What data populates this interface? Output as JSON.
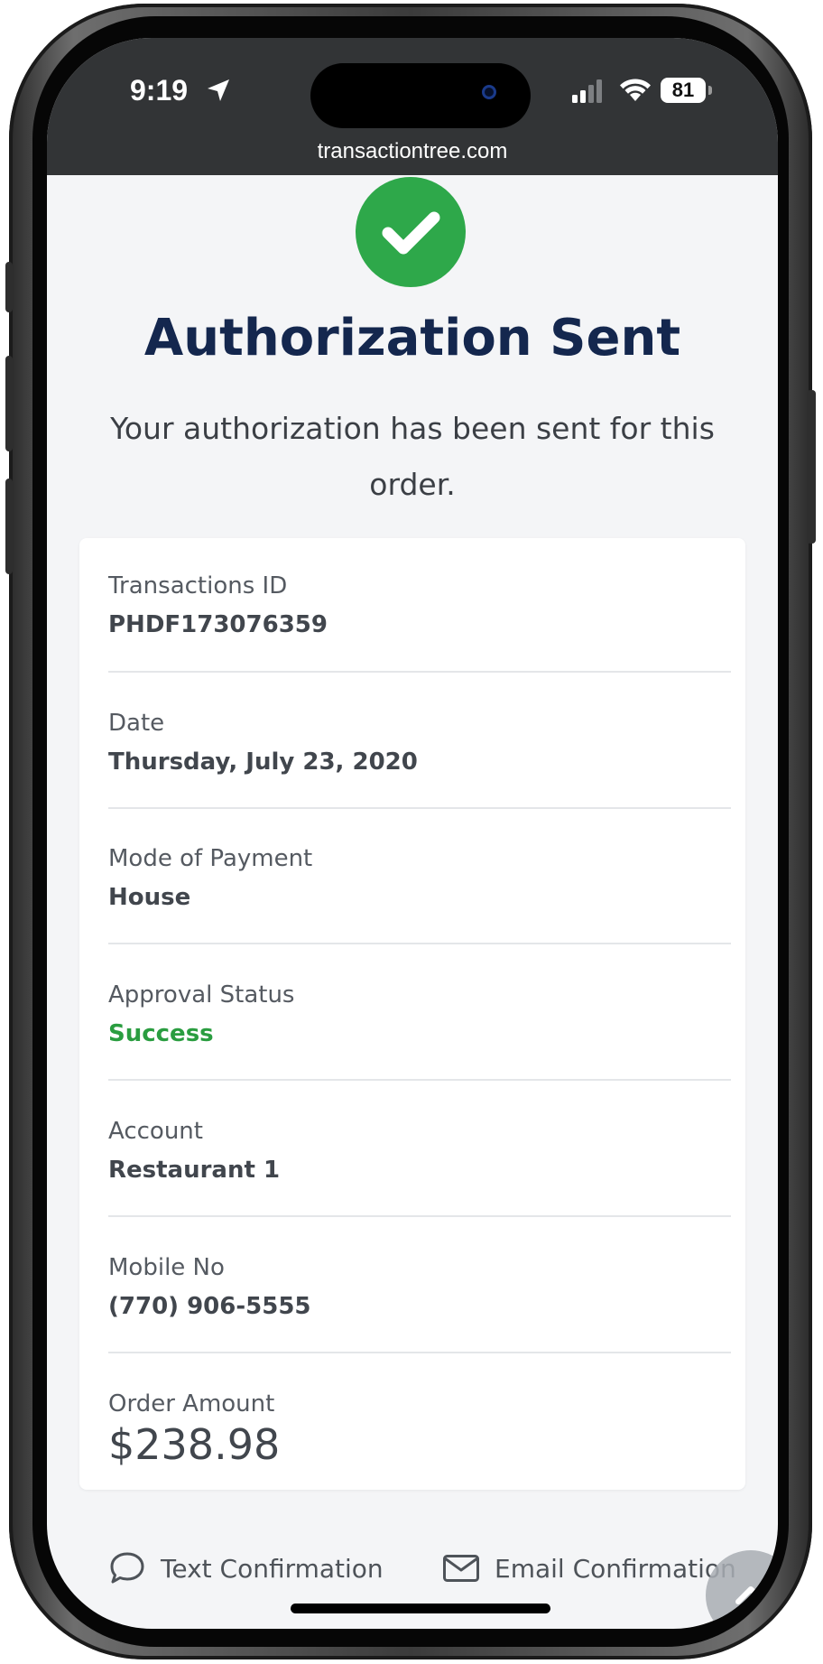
{
  "status_bar": {
    "time": "9:19",
    "battery": "81",
    "url": "transactiontree.com"
  },
  "header": {
    "title": "Authorization Sent",
    "subtitle": "Your authorization has been sent for this order."
  },
  "details": [
    {
      "label": "Transactions ID",
      "value": "PHDF173076359"
    },
    {
      "label": "Date",
      "value": "Thursday, July 23, 2020"
    },
    {
      "label": "Mode of Payment",
      "value": "House"
    },
    {
      "label": "Approval Status",
      "value": "Success"
    },
    {
      "label": "Account",
      "value": "Restaurant 1"
    },
    {
      "label": "Mobile No",
      "value": "(770) 906-5555"
    },
    {
      "label": "Order Amount",
      "value": "$238.98"
    }
  ],
  "footer": {
    "text_confirmation": "Text Confirmation",
    "email_confirmation": "Email Confirmation"
  },
  "colors": {
    "success": "#2ea84a",
    "title": "#14274e",
    "status_bar": "#323436"
  },
  "icons": [
    "location-arrow-icon",
    "signal-icon",
    "wifi-icon",
    "battery-icon",
    "checkmark-icon",
    "chat-bubble-icon",
    "envelope-icon",
    "chevron-up-icon"
  ]
}
